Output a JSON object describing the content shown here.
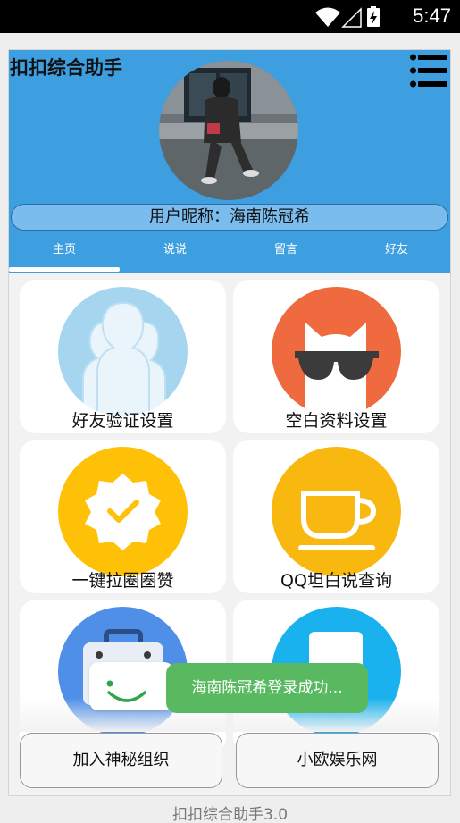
{
  "status_bar": {
    "time": "5:47"
  },
  "header": {
    "title": "扣扣综合助手",
    "nickname": "用户昵称：海南陈冠希",
    "tabs": [
      "主页",
      "说说",
      "留言",
      "好友"
    ],
    "active_tab": "主页"
  },
  "features": [
    {
      "label": "好友验证设置",
      "icon": "users-icon",
      "color": "#a6d5f0"
    },
    {
      "label": "空白资料设置",
      "icon": "cat-sunglasses-icon",
      "color": "#ef6a3e"
    },
    {
      "label": "一键拉圈圈赞",
      "icon": "badge-check-icon",
      "color": "#ffc107"
    },
    {
      "label": "QQ坦白说查询",
      "icon": "cup-icon",
      "color": "#f9b80f"
    },
    {
      "label": "",
      "icon": "briefcase-icon",
      "color": "#4f8fe8"
    },
    {
      "label": "",
      "icon": "document-icon",
      "color": "#1ab2ee"
    }
  ],
  "toast": {
    "message": "海南陈冠希登录成功..."
  },
  "buttons": {
    "join": "加入神秘组织",
    "site": "小欧娱乐网"
  },
  "footer": {
    "version": "扣扣综合助手3.0"
  }
}
